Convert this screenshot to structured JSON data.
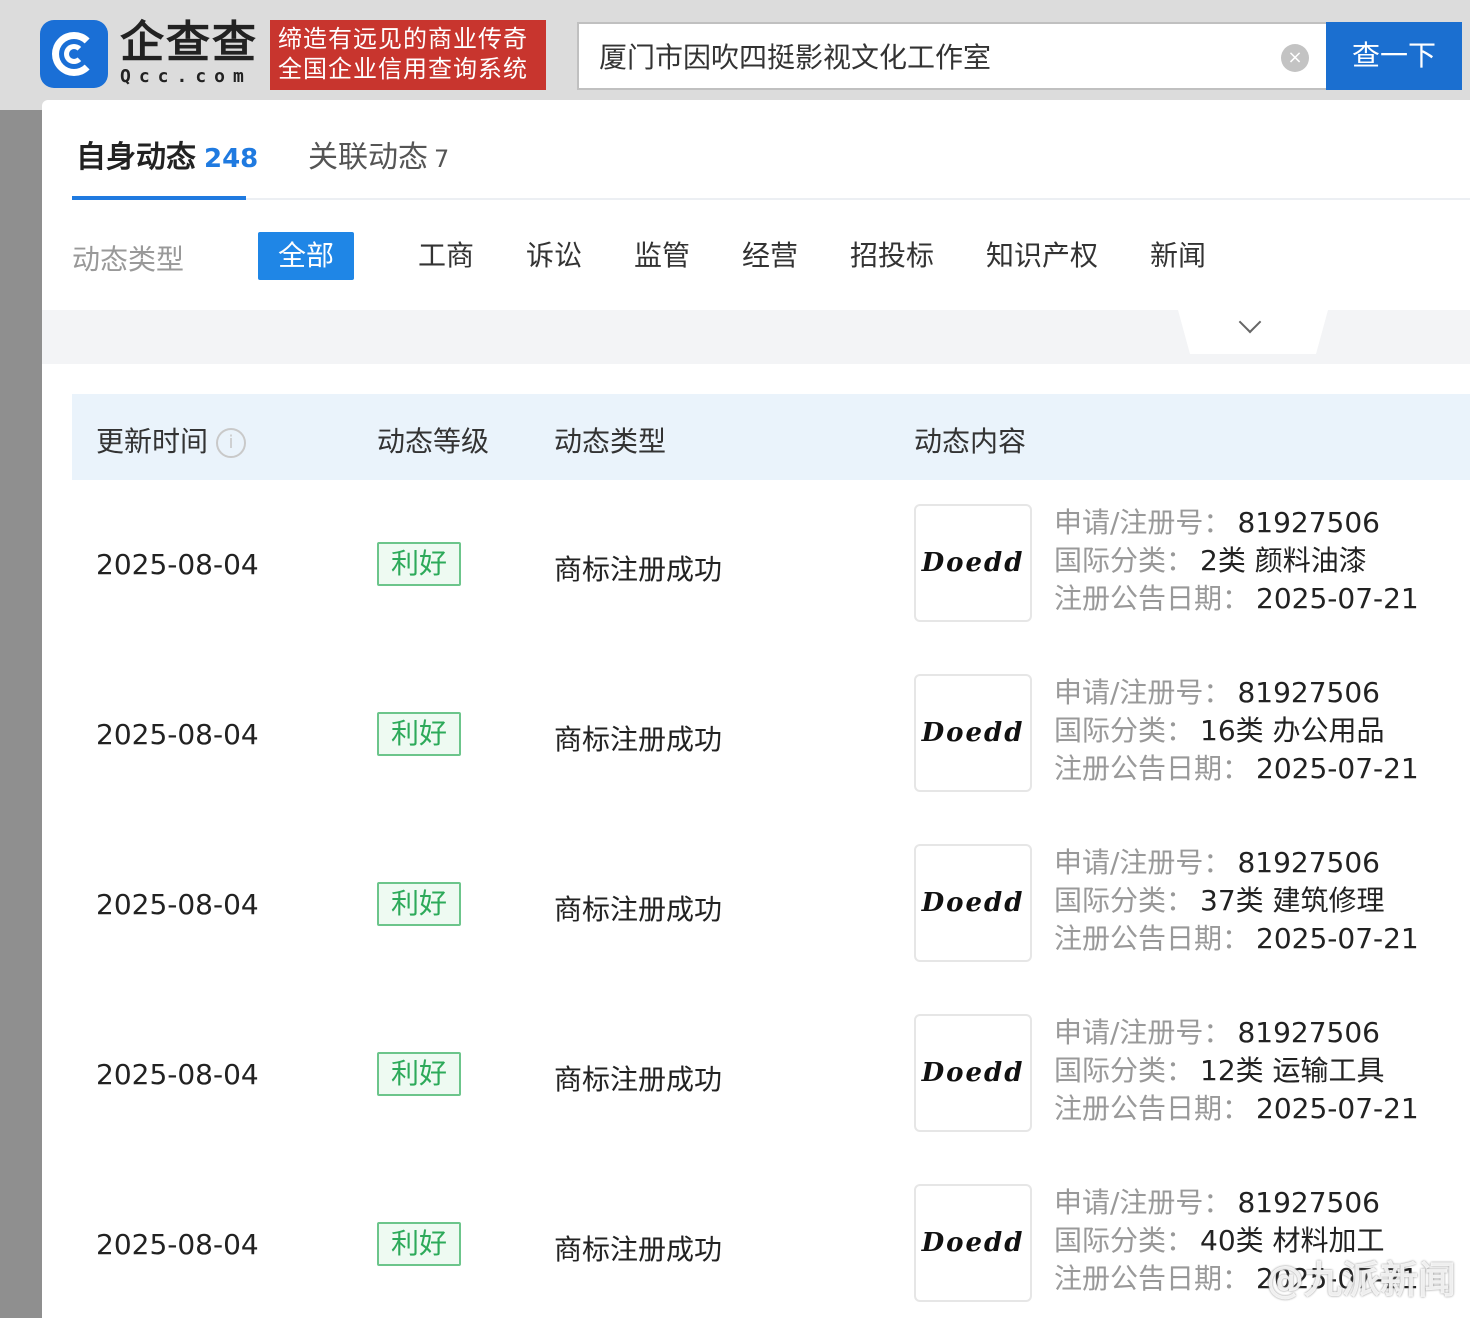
{
  "header": {
    "logo_cn": "企查查",
    "logo_en": "Qcc.com",
    "slogan_line1": "缔造有远见的商业传奇",
    "slogan_line2": "全国企业信用查询系统",
    "search_value": "厦门市因吹四挺影视文化工作室",
    "search_button": "查一下",
    "clear_icon": "×"
  },
  "tabs": {
    "self": {
      "label": "自身动态",
      "count": "248"
    },
    "related": {
      "label": "关联动态",
      "count": "7"
    }
  },
  "filters": {
    "label": "动态类型",
    "items": [
      "全部",
      "工商",
      "诉讼",
      "监管",
      "经营",
      "招投标",
      "知识产权",
      "新闻"
    ]
  },
  "table": {
    "headers": [
      "更新时间",
      "动态等级",
      "动态类型",
      "动态内容"
    ],
    "info_icon": "i",
    "field_labels": {
      "reg_no": "申请/注册号：",
      "class": "国际分类：",
      "date": "注册公告日期："
    },
    "rows": [
      {
        "date": "2025-08-04",
        "level": "利好",
        "type": "商标注册成功",
        "logo": "Doedd",
        "reg_no": "81927506",
        "class": "2类 颜料油漆",
        "pub_date": "2025-07-21"
      },
      {
        "date": "2025-08-04",
        "level": "利好",
        "type": "商标注册成功",
        "logo": "Doedd",
        "reg_no": "81927506",
        "class": "16类 办公用品",
        "pub_date": "2025-07-21"
      },
      {
        "date": "2025-08-04",
        "level": "利好",
        "type": "商标注册成功",
        "logo": "Doedd",
        "reg_no": "81927506",
        "class": "37类 建筑修理",
        "pub_date": "2025-07-21"
      },
      {
        "date": "2025-08-04",
        "level": "利好",
        "type": "商标注册成功",
        "logo": "Doedd",
        "reg_no": "81927506",
        "class": "12类 运输工具",
        "pub_date": "2025-07-21"
      },
      {
        "date": "2025-08-04",
        "level": "利好",
        "type": "商标注册成功",
        "logo": "Doedd",
        "reg_no": "81927506",
        "class": "40类 材料加工",
        "pub_date": "2025-07-21"
      }
    ]
  },
  "watermark": "@九派新闻"
}
